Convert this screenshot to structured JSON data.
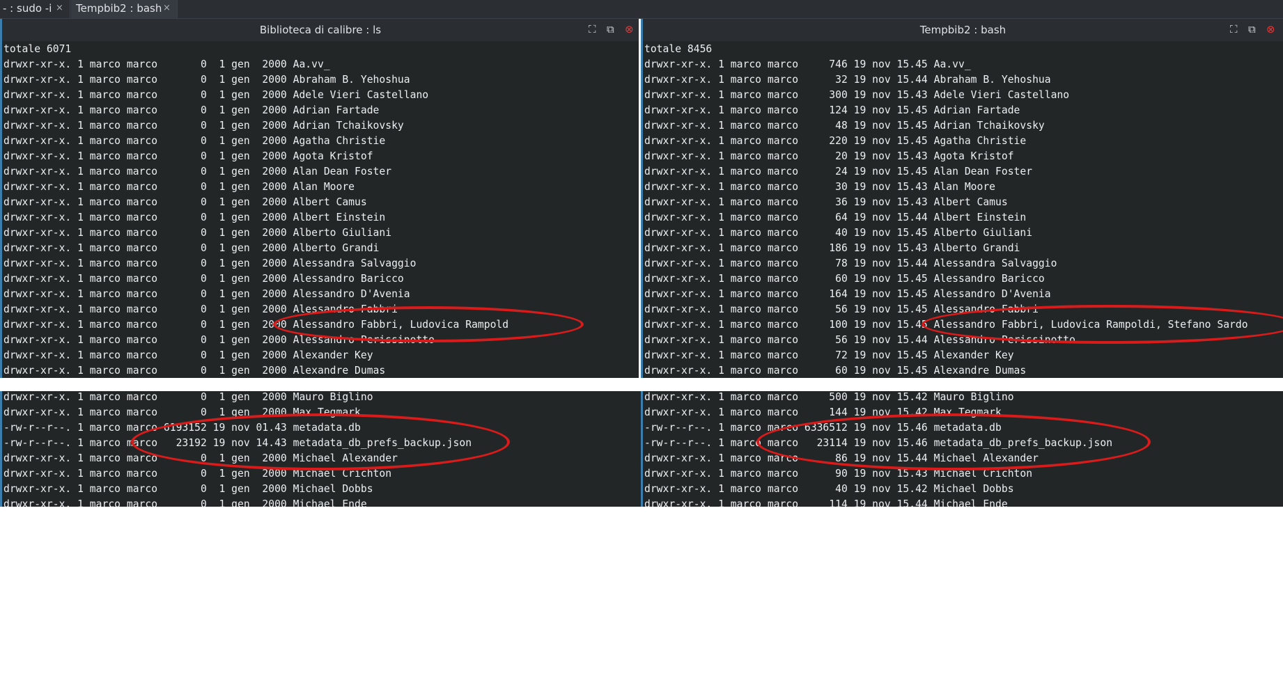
{
  "tabs": [
    {
      "label": "- : sudo -i",
      "close": "×"
    },
    {
      "label": "Tempbib2 : bash",
      "close": "×"
    }
  ],
  "left_pane": {
    "title": "Biblioteca di calibre : ls",
    "controls": {
      "maximize": "⛶",
      "detach": "⧉",
      "close": "⊗"
    },
    "lines": [
      "totale 6071",
      "drwxr-xr-x. 1 marco marco       0  1 gen  2000 Aa.vv_",
      "drwxr-xr-x. 1 marco marco       0  1 gen  2000 Abraham B. Yehoshua",
      "drwxr-xr-x. 1 marco marco       0  1 gen  2000 Adele Vieri Castellano",
      "drwxr-xr-x. 1 marco marco       0  1 gen  2000 Adrian Fartade",
      "drwxr-xr-x. 1 marco marco       0  1 gen  2000 Adrian Tchaikovsky",
      "drwxr-xr-x. 1 marco marco       0  1 gen  2000 Agatha Christie",
      "drwxr-xr-x. 1 marco marco       0  1 gen  2000 Agota Kristof",
      "drwxr-xr-x. 1 marco marco       0  1 gen  2000 Alan Dean Foster",
      "drwxr-xr-x. 1 marco marco       0  1 gen  2000 Alan Moore",
      "drwxr-xr-x. 1 marco marco       0  1 gen  2000 Albert Camus",
      "drwxr-xr-x. 1 marco marco       0  1 gen  2000 Albert Einstein",
      "drwxr-xr-x. 1 marco marco       0  1 gen  2000 Alberto Giuliani",
      "drwxr-xr-x. 1 marco marco       0  1 gen  2000 Alberto Grandi",
      "drwxr-xr-x. 1 marco marco       0  1 gen  2000 Alessandra Salvaggio",
      "drwxr-xr-x. 1 marco marco       0  1 gen  2000 Alessandro Baricco",
      "drwxr-xr-x. 1 marco marco       0  1 gen  2000 Alessandro D'Avenia",
      "drwxr-xr-x. 1 marco marco       0  1 gen  2000 Alessandro Fabbri",
      "drwxr-xr-x. 1 marco marco       0  1 gen  2000 Alessandro Fabbri, Ludovica Rampold",
      "drwxr-xr-x. 1 marco marco       0  1 gen  2000 Alessandro Perissinotto",
      "drwxr-xr-x. 1 marco marco       0  1 gen  2000 Alexander Key",
      "drwxr-xr-x. 1 marco marco       0  1 gen  2000 Alexandre Dumas"
    ]
  },
  "right_pane": {
    "title": "Tempbib2 : bash",
    "controls": {
      "maximize": "⛶",
      "detach": "⧉",
      "close": "⊗"
    },
    "lines": [
      "totale 8456",
      "drwxr-xr-x. 1 marco marco     746 19 nov 15.45 Aa.vv_",
      "drwxr-xr-x. 1 marco marco      32 19 nov 15.44 Abraham B. Yehoshua",
      "drwxr-xr-x. 1 marco marco     300 19 nov 15.43 Adele Vieri Castellano",
      "drwxr-xr-x. 1 marco marco     124 19 nov 15.45 Adrian Fartade",
      "drwxr-xr-x. 1 marco marco      48 19 nov 15.45 Adrian Tchaikovsky",
      "drwxr-xr-x. 1 marco marco     220 19 nov 15.45 Agatha Christie",
      "drwxr-xr-x. 1 marco marco      20 19 nov 15.43 Agota Kristof",
      "drwxr-xr-x. 1 marco marco      24 19 nov 15.45 Alan Dean Foster",
      "drwxr-xr-x. 1 marco marco      30 19 nov 15.43 Alan Moore",
      "drwxr-xr-x. 1 marco marco      36 19 nov 15.43 Albert Camus",
      "drwxr-xr-x. 1 marco marco      64 19 nov 15.44 Albert Einstein",
      "drwxr-xr-x. 1 marco marco      40 19 nov 15.45 Alberto Giuliani",
      "drwxr-xr-x. 1 marco marco     186 19 nov 15.43 Alberto Grandi",
      "drwxr-xr-x. 1 marco marco      78 19 nov 15.44 Alessandra Salvaggio",
      "drwxr-xr-x. 1 marco marco      60 19 nov 15.45 Alessandro Baricco",
      "drwxr-xr-x. 1 marco marco     164 19 nov 15.45 Alessandro D'Avenia",
      "drwxr-xr-x. 1 marco marco      56 19 nov 15.45 Alessandro Fabbri",
      "drwxr-xr-x. 1 marco marco     100 19 nov 15.45 Alessandro Fabbri, Ludovica Rampoldi, Stefano Sardo",
      "drwxr-xr-x. 1 marco marco      56 19 nov 15.44 Alessandro Perissinotto",
      "drwxr-xr-x. 1 marco marco      72 19 nov 15.45 Alexander Key",
      "drwxr-xr-x. 1 marco marco      60 19 nov 15.45 Alexandre Dumas"
    ]
  },
  "bottom_left": {
    "lines": [
      "drwxr-xr-x. 1 marco marco       0  1 gen  2000 Mauro Biglino",
      "drwxr-xr-x. 1 marco marco       0  1 gen  2000 Max Tegmark",
      "-rw-r--r--. 1 marco marco 6193152 19 nov 01.43 metadata.db",
      "-rw-r--r--. 1 marco marco   23192 19 nov 14.43 metadata_db_prefs_backup.json",
      "drwxr-xr-x. 1 marco marco       0  1 gen  2000 Michael Alexander",
      "drwxr-xr-x. 1 marco marco       0  1 gen  2000 Michael Crichton",
      "drwxr-xr-x. 1 marco marco       0  1 gen  2000 Michael Dobbs",
      "drwxr-xr-x. 1 marco marco       0  1 gen  2000 Michael Ende"
    ]
  },
  "bottom_right": {
    "lines": [
      "drwxr-xr-x. 1 marco marco     500 19 nov 15.42 Mauro Biglino",
      "drwxr-xr-x. 1 marco marco     144 19 nov 15.42 Max Tegmark",
      "-rw-r--r--. 1 marco marco 6336512 19 nov 15.46 metadata.db",
      "-rw-r--r--. 1 marco marco   23114 19 nov 15.46 metadata_db_prefs_backup.json",
      "drwxr-xr-x. 1 marco marco      86 19 nov 15.44 Michael Alexander",
      "drwxr-xr-x. 1 marco marco      90 19 nov 15.43 Michael Crichton",
      "drwxr-xr-x. 1 marco marco      40 19 nov 15.42 Michael Dobbs",
      "drwxr-xr-x. 1 marco marco     114 19 nov 15.44 Michael Ende"
    ]
  },
  "colors": {
    "terminal_bg": "#232627",
    "terminal_fg": "#eceff1",
    "annotation": "#d81b1b",
    "pane_focus_border": "#3b7dac"
  }
}
